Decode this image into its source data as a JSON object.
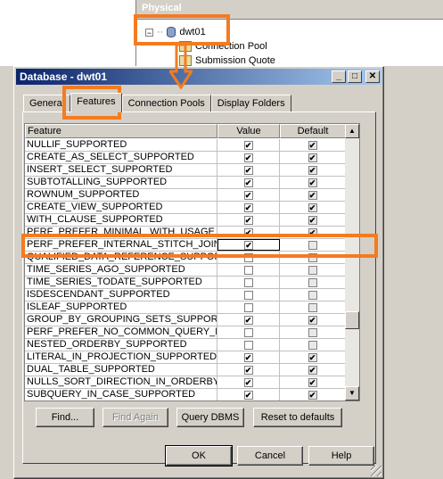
{
  "background": {
    "panel_header": "Physical",
    "tree": [
      {
        "label": "dwt01"
      },
      {
        "label": "Connection Pool"
      },
      {
        "label": "Submission Quote"
      }
    ]
  },
  "dialog": {
    "title": "Database - dwt01",
    "title_buttons": {
      "minimize": "_",
      "maximize": "□",
      "close": "✕"
    },
    "tabs": [
      {
        "label": "General"
      },
      {
        "label": "Features",
        "active": true
      },
      {
        "label": "Connection Pools"
      },
      {
        "label": "Display Folders"
      }
    ],
    "grid": {
      "columns": [
        "Feature",
        "Value",
        "Default"
      ],
      "rows": [
        {
          "feature": "NULLIF_SUPPORTED",
          "value": true,
          "default": true
        },
        {
          "feature": "CREATE_AS_SELECT_SUPPORTED",
          "value": true,
          "default": true
        },
        {
          "feature": "INSERT_SELECT_SUPPORTED",
          "value": true,
          "default": true
        },
        {
          "feature": "SUBTOTALLING_SUPPORTED",
          "value": true,
          "default": true
        },
        {
          "feature": "ROWNUM_SUPPORTED",
          "value": true,
          "default": true
        },
        {
          "feature": "CREATE_VIEW_SUPPORTED",
          "value": true,
          "default": true
        },
        {
          "feature": "WITH_CLAUSE_SUPPORTED",
          "value": true,
          "default": true
        },
        {
          "feature": "PERF_PREFER_MINIMAL_WITH_USAGE",
          "value": true,
          "default": true
        },
        {
          "feature": "PERF_PREFER_INTERNAL_STITCH_JOIN",
          "value": true,
          "default": false,
          "selected": true
        },
        {
          "feature": "QUALIFIED_DATA_REFERENCE_SUPPORTE",
          "value": false,
          "default": false
        },
        {
          "feature": "TIME_SERIES_AGO_SUPPORTED",
          "value": false,
          "default": false
        },
        {
          "feature": "TIME_SERIES_TODATE_SUPPORTED",
          "value": false,
          "default": false
        },
        {
          "feature": "ISDESCENDANT_SUPPORTED",
          "value": false,
          "default": false
        },
        {
          "feature": "ISLEAF_SUPPORTED",
          "value": false,
          "default": false
        },
        {
          "feature": "GROUP_BY_GROUPING_SETS_SUPPORTED",
          "value": true,
          "default": true
        },
        {
          "feature": "PERF_PREFER_NO_COMMON_QUERY_FAC",
          "value": false,
          "default": false
        },
        {
          "feature": "NESTED_ORDERBY_SUPPORTED",
          "value": false,
          "default": false
        },
        {
          "feature": "LITERAL_IN_PROJECTION_SUPPORTED",
          "value": true,
          "default": true
        },
        {
          "feature": "DUAL_TABLE_SUPPORTED",
          "value": true,
          "default": true
        },
        {
          "feature": "NULLS_SORT_DIRECTION_IN_ORDERBY_S",
          "value": true,
          "default": true
        },
        {
          "feature": "SUBQUERY_IN_CASE_SUPPORTED",
          "value": true,
          "default": true
        }
      ]
    },
    "buttons": {
      "find": "Find...",
      "find_again": "Find Again",
      "query_dbms": "Query DBMS",
      "reset": "Reset to defaults",
      "ok": "OK",
      "cancel": "Cancel",
      "help": "Help"
    },
    "check_glyph": "✔"
  },
  "colors": {
    "annotation": "#f47b20",
    "titlebar": "#0a246a"
  }
}
